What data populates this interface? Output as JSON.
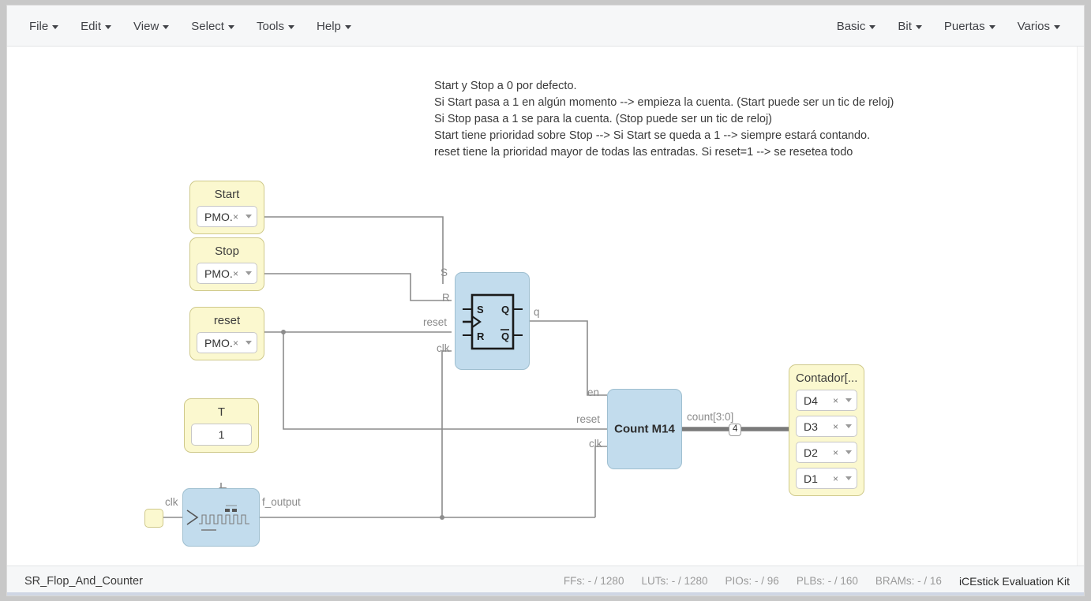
{
  "menu": {
    "left": [
      {
        "label": "File",
        "name": "menu-file"
      },
      {
        "label": "Edit",
        "name": "menu-edit"
      },
      {
        "label": "View",
        "name": "menu-view"
      },
      {
        "label": "Select",
        "name": "menu-select"
      },
      {
        "label": "Tools",
        "name": "menu-tools"
      },
      {
        "label": "Help",
        "name": "menu-help"
      }
    ],
    "right": [
      {
        "label": "Basic",
        "name": "menu-basic"
      },
      {
        "label": "Bit",
        "name": "menu-bit"
      },
      {
        "label": "Puertas",
        "name": "menu-puertas"
      },
      {
        "label": "Varios",
        "name": "menu-varios"
      }
    ]
  },
  "comment": {
    "lines": [
      "Start y Stop a 0 por defecto.",
      "Si Start pasa a 1 en algún momento --> empieza la cuenta. (Start puede ser un tic de reloj)",
      "Si Stop pasa a 1 se para la cuenta. (Stop puede ser un tic de reloj)",
      "Start tiene prioridad sobre Stop --> Si Start se queda a 1 --> siempre estará contando.",
      "reset tiene la prioridad mayor de todas las entradas. Si reset=1 --> se resetea todo"
    ]
  },
  "blocks": {
    "start": {
      "title": "Start",
      "pin": "PMO...",
      "clear": "×"
    },
    "stop": {
      "title": "Stop",
      "pin": "PMO...",
      "clear": "×"
    },
    "reset": {
      "title": "reset",
      "pin": "PMO...",
      "clear": "×"
    },
    "tconst": {
      "title": "T",
      "value": "1"
    },
    "divider": {
      "inport": "clk",
      "outport": "f_output",
      "wire_label": "T_sg"
    },
    "srflop": {
      "inports": [
        "S",
        "R",
        "reset",
        "clk"
      ],
      "outport": "q",
      "symbol": {
        "s": "S",
        "r": "R",
        "q": "Q",
        "qbar": "Q̄"
      }
    },
    "counter": {
      "title": "Count M14",
      "inports": [
        "en",
        "reset",
        "clk"
      ],
      "outport": "count[3:0]",
      "bus_width": "4"
    },
    "output": {
      "title": "Contador[...",
      "pins": [
        {
          "label": "D4",
          "clear": "×"
        },
        {
          "label": "D3",
          "clear": "×"
        },
        {
          "label": "D2",
          "clear": "×"
        },
        {
          "label": "D1",
          "clear": "×"
        }
      ]
    }
  },
  "status": {
    "project": "SR_Flop_And_Counter",
    "stats": [
      {
        "key": "FFs:",
        "value": "- / 1280"
      },
      {
        "key": "LUTs:",
        "value": "- / 1280"
      },
      {
        "key": "PIOs:",
        "value": "- / 96"
      },
      {
        "key": "PLBs:",
        "value": "- / 160"
      },
      {
        "key": "BRAMs:",
        "value": "- / 16"
      }
    ],
    "board": "iCEstick Evaluation Kit"
  },
  "colors": {
    "block_yellow": "#fbf8cf",
    "block_blue": "#c2dced",
    "wire": "#8c8c8c",
    "bus": "#7a7a7a"
  }
}
